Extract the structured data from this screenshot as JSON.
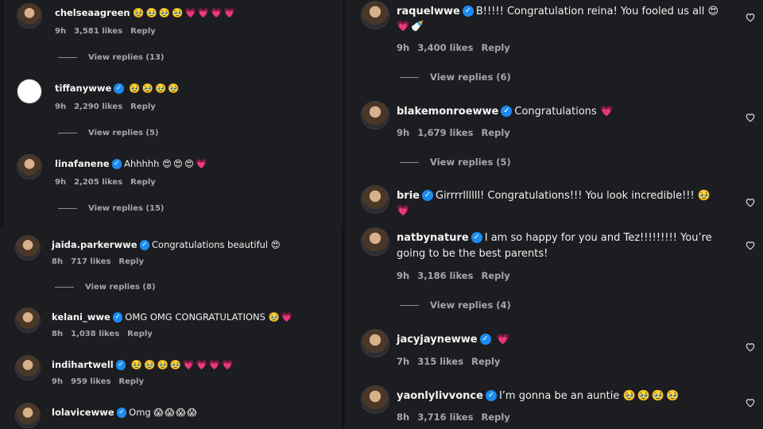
{
  "left_top": [
    {
      "username": "chelseaagreen",
      "verified": false,
      "text": "",
      "emojis": [
        "🥹",
        "🥹",
        "🥹",
        "🥹",
        "💗",
        "💗",
        "💗",
        "💗"
      ],
      "time": "9h",
      "likes": "3,581 likes",
      "reply": "Reply",
      "view_replies": "View replies (13)"
    },
    {
      "username": "tiffanywwe",
      "verified": true,
      "text": "",
      "emojis": [
        "🥹",
        "🥹",
        "🥹",
        "🥹"
      ],
      "time": "9h",
      "likes": "2,290 likes",
      "reply": "Reply",
      "view_replies": "View replies (5)"
    },
    {
      "username": "linafanene",
      "verified": true,
      "text": "Ahhhhh",
      "emojis": [
        "😍",
        "😍",
        "😍",
        "💗"
      ],
      "time": "9h",
      "likes": "2,205 likes",
      "reply": "Reply",
      "view_replies": "View replies (15)"
    }
  ],
  "left_bottom": [
    {
      "username": "jaida.parkerwwe",
      "verified": true,
      "text": "Congratulations beautiful",
      "emojis": [
        "😍"
      ],
      "time": "8h",
      "likes": "717 likes",
      "reply": "Reply",
      "view_replies": "View replies (8)"
    },
    {
      "username": "kelani_wwe",
      "verified": true,
      "text": "OMG OMG CONGRATULATIONS",
      "emojis": [
        "🥹",
        "💗"
      ],
      "time": "8h",
      "likes": "1,038 likes",
      "reply": "Reply",
      "view_replies": ""
    },
    {
      "username": "indihartwell",
      "verified": true,
      "text": "",
      "emojis": [
        "🥹",
        "🥹",
        "🥹",
        "🥹",
        "💗",
        "💗",
        "💗",
        "💗"
      ],
      "time": "9h",
      "likes": "959 likes",
      "reply": "Reply",
      "view_replies": ""
    },
    {
      "username": "lolavicewwe",
      "verified": true,
      "text": "Omg",
      "emojis": [
        "😱",
        "😱",
        "😱",
        "😱"
      ],
      "time": "",
      "likes": "",
      "reply": "",
      "view_replies": ""
    }
  ],
  "right": [
    {
      "username": "raquelwwe",
      "verified": true,
      "text": "B!!!!! Congratulation reina! You fooled us all",
      "emojis": [
        "😍"
      ],
      "line2": [
        "💗",
        "🍼"
      ],
      "time": "9h",
      "likes": "3,400 likes",
      "reply": "Reply",
      "view_replies": "View replies (6)"
    },
    {
      "username": "blakemonroewwe",
      "verified": true,
      "text": "Congratulations",
      "emojis": [
        "💗"
      ],
      "time": "9h",
      "likes": "1,679 likes",
      "reply": "Reply",
      "view_replies": "View replies (5)"
    },
    {
      "username": "brie",
      "verified": true,
      "text": "Girrrrllllll! Congratulations!!! You look incredible!!!",
      "emojis": [
        "🥹"
      ],
      "line2": [
        "💗"
      ],
      "time": "",
      "likes": "",
      "reply": "",
      "view_replies": ""
    },
    {
      "username": "natbynature",
      "verified": true,
      "text": "I am so happy for you and Tez!!!!!!!!! You’re",
      "line2_text": "going to be the best parents!",
      "emojis": [],
      "time": "9h",
      "likes": "3,186 likes",
      "reply": "Reply",
      "view_replies": "View replies (4)"
    },
    {
      "username": "jacyjaynewwe",
      "verified": true,
      "text": "",
      "emojis": [
        "💗"
      ],
      "time": "7h",
      "likes": "315 likes",
      "reply": "Reply",
      "view_replies": ""
    },
    {
      "username": "yaonlylivvonce",
      "verified": true,
      "text": "I’m gonna be an auntie",
      "emojis": [
        "🥹",
        "🥹",
        "🥹",
        "🥹"
      ],
      "time": "8h",
      "likes": "3,716 likes",
      "reply": "Reply",
      "view_replies": ""
    }
  ],
  "icons": {
    "verified": "verified-badge-icon",
    "like": "heart-outline-icon"
  },
  "colors": {
    "panel": "#1c1d20",
    "verified": "#1d8cf2",
    "meta": "#a6a7ab"
  }
}
